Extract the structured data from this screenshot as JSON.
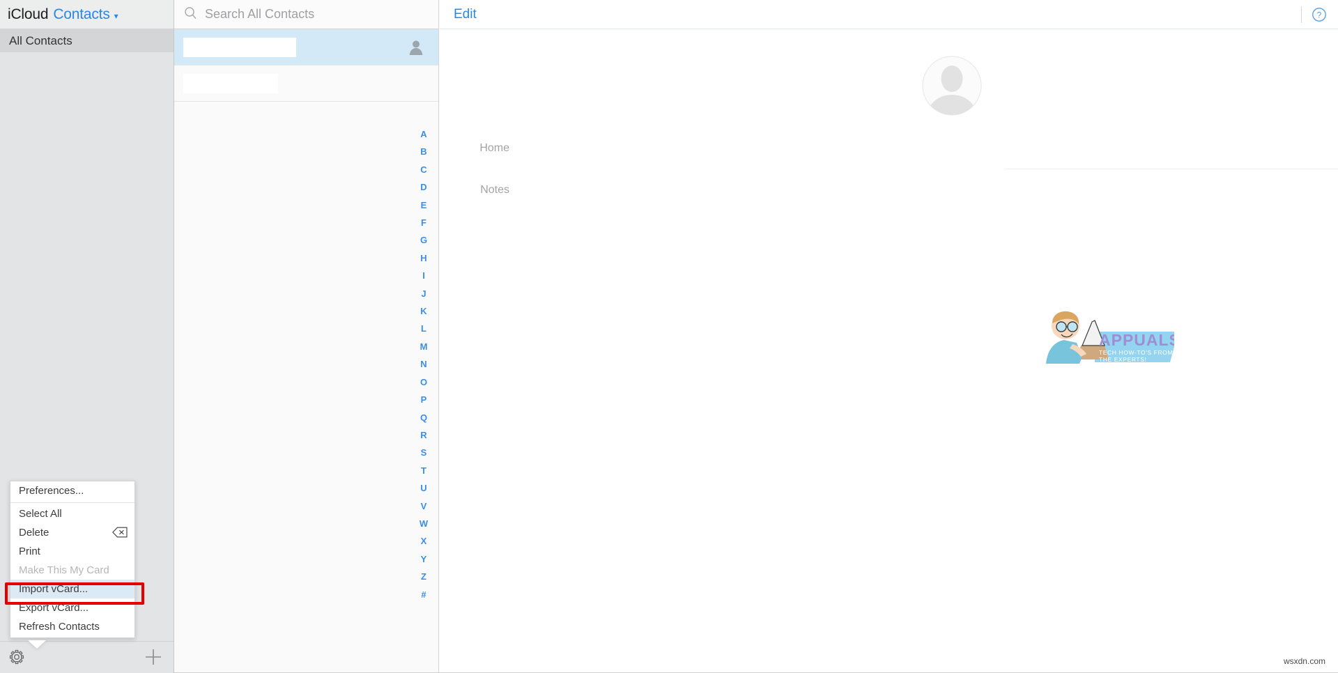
{
  "app": {
    "brand": "iCloud",
    "section": "Contacts",
    "chevron_icon": "chevron-down-icon"
  },
  "sidebar": {
    "items": [
      {
        "label": "All Contacts",
        "selected": true
      }
    ],
    "toolbar": {
      "settings_icon": "gear-icon",
      "add_icon": "plus-icon"
    }
  },
  "contacts": {
    "search": {
      "placeholder": "Search All Contacts",
      "value": "",
      "icon": "search-icon"
    },
    "rows": [
      {
        "name": "",
        "redaction_width": 162,
        "selected": true,
        "avatar_icon": "person-icon"
      },
      {
        "name": "",
        "redaction_width": 136,
        "selected": false,
        "avatar_icon": ""
      }
    ],
    "alphabet_index": [
      "A",
      "B",
      "C",
      "D",
      "E",
      "F",
      "G",
      "H",
      "I",
      "J",
      "K",
      "L",
      "M",
      "N",
      "O",
      "P",
      "Q",
      "R",
      "S",
      "T",
      "U",
      "V",
      "W",
      "X",
      "Y",
      "Z",
      "#"
    ]
  },
  "detail": {
    "edit_label": "Edit",
    "help_icon": "question-circle-icon",
    "avatar_icon": "person-placeholder-icon",
    "fields": [
      {
        "label": "Home",
        "value": ""
      },
      {
        "label": "Notes",
        "value": ""
      }
    ]
  },
  "context_menu": {
    "items": [
      {
        "label": "Preferences...",
        "disabled": false,
        "highlighted": false,
        "separator_after": true,
        "shortcut_icon": ""
      },
      {
        "label": "Select All",
        "disabled": false,
        "highlighted": false,
        "separator_after": false,
        "shortcut_icon": ""
      },
      {
        "label": "Delete",
        "disabled": false,
        "highlighted": false,
        "separator_after": false,
        "shortcut_icon": "backspace-icon"
      },
      {
        "label": "Print",
        "disabled": false,
        "highlighted": false,
        "separator_after": false,
        "shortcut_icon": ""
      },
      {
        "label": "Make This My Card",
        "disabled": true,
        "highlighted": false,
        "separator_after": false,
        "shortcut_icon": ""
      },
      {
        "label": "Import vCard...",
        "disabled": false,
        "highlighted": true,
        "separator_after": false,
        "shortcut_icon": ""
      },
      {
        "label": "Export vCard...",
        "disabled": false,
        "highlighted": false,
        "separator_after": false,
        "shortcut_icon": ""
      },
      {
        "label": "Refresh Contacts",
        "disabled": false,
        "highlighted": false,
        "separator_after": false,
        "shortcut_icon": ""
      }
    ]
  },
  "annotation": {
    "highlight_color": "#e50000",
    "target_label": "Import vCard..."
  },
  "watermarks": {
    "logo_text": "APPUALS",
    "logo_tagline_line1": "TECH HOW-TO'S FROM",
    "logo_tagline_line2": "THE EXPERTS!",
    "site": "wsxdn.com"
  },
  "colors": {
    "accent": "#2b87e3",
    "sidebar_bg": "#e3e4e6",
    "selected_row": "#d3e9f7",
    "annotation_red": "#e50000"
  }
}
